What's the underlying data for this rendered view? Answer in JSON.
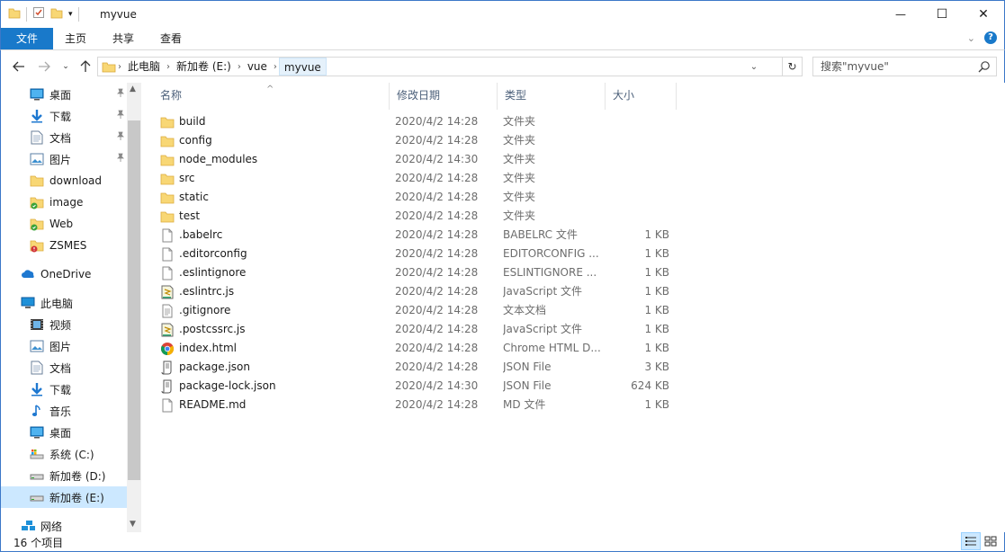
{
  "window": {
    "title": "myvue",
    "minimize_symbol": "—",
    "maximize_symbol": "☐",
    "close_symbol": "✕"
  },
  "ribbon": {
    "tabs": [
      "文件",
      "主页",
      "共享",
      "查看"
    ]
  },
  "address": {
    "breadcrumbs": [
      "此电脑",
      "新加卷 (E:)",
      "vue",
      "myvue"
    ],
    "search_placeholder": "搜索\"myvue\""
  },
  "nav": {
    "items": [
      {
        "label": "桌面",
        "icon": "desktop-icon",
        "pinned": true
      },
      {
        "label": "下载",
        "icon": "download-arrow-icon",
        "pinned": true
      },
      {
        "label": "文档",
        "icon": "document-icon",
        "pinned": true
      },
      {
        "label": "图片",
        "icon": "pictures-icon",
        "pinned": true
      },
      {
        "label": "download",
        "icon": "folder-icon",
        "pinned": false
      },
      {
        "label": "image",
        "icon": "folder-synced-icon",
        "pinned": false
      },
      {
        "label": "Web",
        "icon": "folder-synced-icon",
        "pinned": false
      },
      {
        "label": "ZSMES",
        "icon": "folder-error-icon",
        "pinned": false
      },
      {
        "label": "OneDrive",
        "icon": "onedrive-icon",
        "pinned": false
      },
      {
        "label": "此电脑",
        "icon": "this-pc-icon",
        "pinned": false
      },
      {
        "label": "视频",
        "icon": "video-icon",
        "pinned": false
      },
      {
        "label": "图片",
        "icon": "pictures-icon",
        "pinned": false
      },
      {
        "label": "文档",
        "icon": "document-icon",
        "pinned": false
      },
      {
        "label": "下载",
        "icon": "download-arrow-icon",
        "pinned": false
      },
      {
        "label": "音乐",
        "icon": "music-icon",
        "pinned": false
      },
      {
        "label": "桌面",
        "icon": "desktop-icon",
        "pinned": false
      },
      {
        "label": "系统 (C:)",
        "icon": "system-drive-icon",
        "pinned": false
      },
      {
        "label": "新加卷 (D:)",
        "icon": "drive-icon",
        "pinned": false
      },
      {
        "label": "新加卷 (E:)",
        "icon": "drive-icon",
        "pinned": false,
        "selected": true
      },
      {
        "label": "网络",
        "icon": "network-icon",
        "pinned": false
      }
    ]
  },
  "files": {
    "columns": [
      "名称",
      "修改日期",
      "类型",
      "大小"
    ],
    "rows": [
      {
        "name": "build",
        "date": "2020/4/2 14:28",
        "type": "文件夹",
        "size": "",
        "icon": "folder-icon"
      },
      {
        "name": "config",
        "date": "2020/4/2 14:28",
        "type": "文件夹",
        "size": "",
        "icon": "folder-icon"
      },
      {
        "name": "node_modules",
        "date": "2020/4/2 14:30",
        "type": "文件夹",
        "size": "",
        "icon": "folder-icon"
      },
      {
        "name": "src",
        "date": "2020/4/2 14:28",
        "type": "文件夹",
        "size": "",
        "icon": "folder-icon"
      },
      {
        "name": "static",
        "date": "2020/4/2 14:28",
        "type": "文件夹",
        "size": "",
        "icon": "folder-icon"
      },
      {
        "name": "test",
        "date": "2020/4/2 14:28",
        "type": "文件夹",
        "size": "",
        "icon": "folder-icon"
      },
      {
        "name": ".babelrc",
        "date": "2020/4/2 14:28",
        "type": "BABELRC 文件",
        "size": "1 KB",
        "icon": "blank-file-icon"
      },
      {
        "name": ".editorconfig",
        "date": "2020/4/2 14:28",
        "type": "EDITORCONFIG ...",
        "size": "1 KB",
        "icon": "blank-file-icon"
      },
      {
        "name": ".eslintignore",
        "date": "2020/4/2 14:28",
        "type": "ESLINTIGNORE ...",
        "size": "1 KB",
        "icon": "blank-file-icon"
      },
      {
        "name": ".eslintrc.js",
        "date": "2020/4/2 14:28",
        "type": "JavaScript 文件",
        "size": "1 KB",
        "icon": "js-file-icon"
      },
      {
        "name": ".gitignore",
        "date": "2020/4/2 14:28",
        "type": "文本文档",
        "size": "1 KB",
        "icon": "text-file-icon"
      },
      {
        "name": ".postcssrc.js",
        "date": "2020/4/2 14:28",
        "type": "JavaScript 文件",
        "size": "1 KB",
        "icon": "js-file-icon"
      },
      {
        "name": "index.html",
        "date": "2020/4/2 14:28",
        "type": "Chrome HTML D...",
        "size": "1 KB",
        "icon": "chrome-icon"
      },
      {
        "name": "package.json",
        "date": "2020/4/2 14:28",
        "type": "JSON File",
        "size": "3 KB",
        "icon": "json-file-icon"
      },
      {
        "name": "package-lock.json",
        "date": "2020/4/2 14:30",
        "type": "JSON File",
        "size": "624 KB",
        "icon": "json-file-icon"
      },
      {
        "name": "README.md",
        "date": "2020/4/2 14:28",
        "type": "MD 文件",
        "size": "1 KB",
        "icon": "blank-file-icon"
      }
    ]
  },
  "status": {
    "item_count": "16 个项目"
  },
  "colors": {
    "accent": "#1979ca",
    "folder": "#f8d775",
    "selection": "#cce8ff"
  }
}
